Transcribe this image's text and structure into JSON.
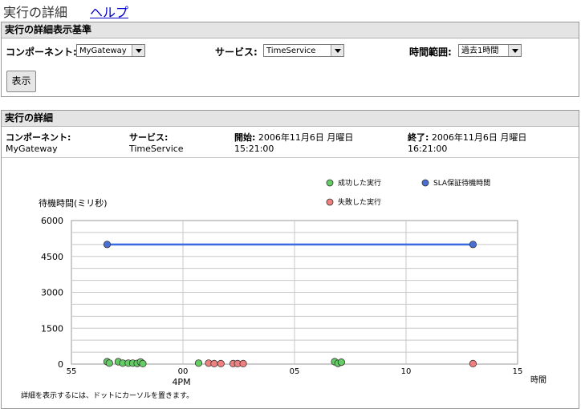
{
  "header": {
    "title": "実行の詳細",
    "help": "ヘルプ"
  },
  "criteria": {
    "title": "実行の詳細表示基準",
    "component_label": "コンポーネント:",
    "component_value": "MyGateway",
    "service_label": "サービス:",
    "service_value": "TimeService",
    "range_label": "時間範囲:",
    "range_value": "過去1時間",
    "show_button": "表示"
  },
  "details": {
    "title": "実行の詳細",
    "component_label": "コンポーネント:",
    "component_value": "MyGateway",
    "service_label": "サービス:",
    "service_value": "TimeService",
    "start_label": "開始:",
    "start_date": "2006年11月6日 月曜日",
    "start_time": "15:21:00",
    "end_label": "終了:",
    "end_date": "2006年11月6日 月曜日",
    "end_time": "16:21:00",
    "hint": "詳細を表示するには、ドットにカーソルを置きます。"
  },
  "chart_data": {
    "type": "scatter",
    "ylabel": "待機時間(ミリ秒)",
    "xlabel": "時間",
    "ylim": [
      0,
      6000
    ],
    "yticks": [
      "0",
      "1500",
      "3000",
      "4500",
      "6000"
    ],
    "xticks": [
      "55",
      "00",
      "05",
      "10",
      "15"
    ],
    "xtick_values": [
      -5,
      0,
      5,
      10,
      15
    ],
    "xlim": [
      -5,
      15
    ],
    "x_hour_label": "4PM",
    "colors": {
      "success": "#66cc66",
      "failed": "#f08080",
      "sla": "#4a6fd0",
      "sla_line": "#3a6ae0"
    },
    "legend": [
      {
        "name": "成功した実行",
        "color": "#66cc66"
      },
      {
        "name": "SLA保証待機時間",
        "color": "#4a6fd0"
      },
      {
        "name": "失敗した実行",
        "color": "#f08080"
      }
    ],
    "series": [
      {
        "name": "成功した実行",
        "points": [
          [
            -3.4,
            100
          ],
          [
            -3.3,
            40
          ],
          [
            -2.9,
            100
          ],
          [
            -2.7,
            40
          ],
          [
            -2.45,
            40
          ],
          [
            -2.25,
            40
          ],
          [
            -2.05,
            30
          ],
          [
            -1.9,
            90
          ],
          [
            -1.8,
            20
          ],
          [
            0.7,
            40
          ],
          [
            6.8,
            100
          ],
          [
            6.95,
            30
          ],
          [
            7.1,
            80
          ]
        ]
      },
      {
        "name": "失敗した実行",
        "points": [
          [
            1.15,
            40
          ],
          [
            1.4,
            20
          ],
          [
            1.7,
            20
          ],
          [
            2.25,
            20
          ],
          [
            2.45,
            20
          ],
          [
            2.7,
            20
          ],
          [
            13.0,
            20
          ]
        ]
      },
      {
        "name": "SLA保証待機時間",
        "points": [
          [
            -3.4,
            5000
          ],
          [
            13.0,
            5000
          ]
        ]
      }
    ]
  }
}
